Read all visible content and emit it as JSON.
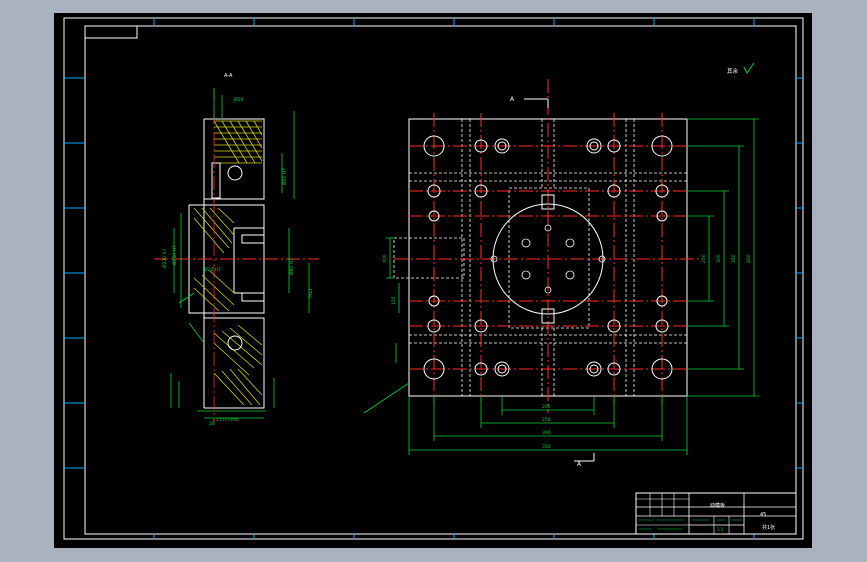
{
  "colors": {
    "background": "#000000",
    "frame": "#ffffff",
    "center_line": "#ff2a2a",
    "dimension": "#00d23c",
    "hidden": "#ffffff",
    "hatch": "#d4d400",
    "accent": "#00a8ff"
  },
  "section_view": {
    "label": "A-A"
  },
  "plan_view": {
    "section_mark_top": "A",
    "section_mark_bottom": "A",
    "roughness_note": "其余",
    "dims_bottom": [
      "200",
      "250",
      "300",
      "350"
    ],
    "dims_right": [
      "250",
      "300",
      "350",
      "400"
    ],
    "dims_left": [
      "100",
      "150"
    ]
  },
  "title_block": {
    "drawing_name": "动模板",
    "material": "45",
    "scale": "1:1",
    "sheet": "共1张"
  }
}
